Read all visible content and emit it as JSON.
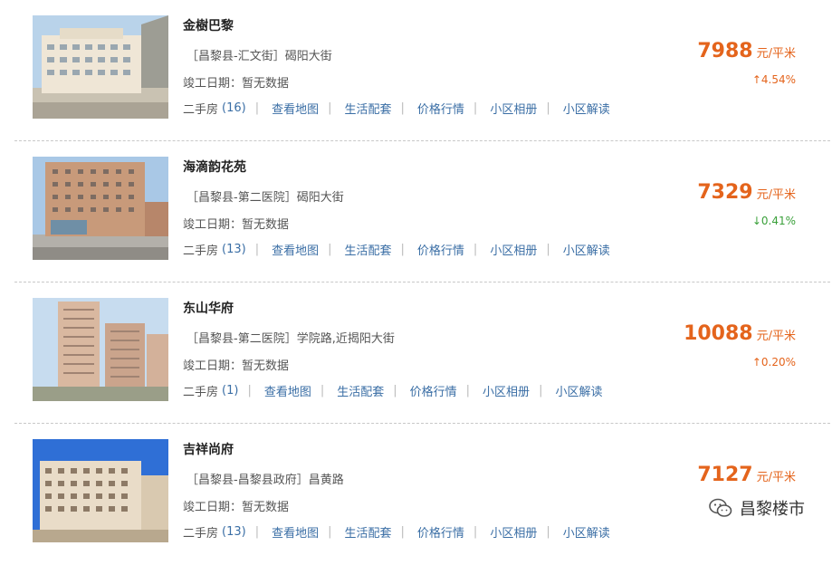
{
  "listings": [
    {
      "name": "金樹巴黎",
      "address": "［昌黎县-汇文街］碣阳大街",
      "completion": "竣工日期：暂无数据",
      "secondhand": "二手房",
      "secondhand_count": "(16)",
      "links": [
        "查看地图",
        "生活配套",
        "价格行情",
        "小区相册",
        "小区解读"
      ],
      "price": "7988",
      "unit": "元/平米",
      "change": "↑4.54%",
      "trend": "up"
    },
    {
      "name": "海滴韵花苑",
      "address": "［昌黎县-第二医院］碣阳大街",
      "completion": "竣工日期：暂无数据",
      "secondhand": "二手房",
      "secondhand_count": "(13)",
      "links": [
        "查看地图",
        "生活配套",
        "价格行情",
        "小区相册",
        "小区解读"
      ],
      "price": "7329",
      "unit": "元/平米",
      "change": "↓0.41%",
      "trend": "down"
    },
    {
      "name": "东山华府",
      "address": "［昌黎县-第二医院］学院路,近揭阳大街",
      "completion": "竣工日期：暂无数据",
      "secondhand": "二手房",
      "secondhand_count": "(1)",
      "links": [
        "查看地图",
        "生活配套",
        "价格行情",
        "小区相册",
        "小区解读"
      ],
      "price": "10088",
      "unit": "元/平米",
      "change": "↑0.20%",
      "trend": "up"
    },
    {
      "name": "吉祥尚府",
      "address": "［昌黎县-昌黎县政府］昌黄路",
      "completion": "竣工日期：暂无数据",
      "secondhand": "二手房",
      "secondhand_count": "(13)",
      "links": [
        "查看地图",
        "生活配套",
        "价格行情",
        "小区相册",
        "小区解读"
      ],
      "price": "7127",
      "unit": "元/平米",
      "change": "",
      "trend": "up"
    }
  ],
  "watermark": {
    "text": "昌黎楼市",
    "icon": "wechat-icon"
  },
  "colors": {
    "price": "#e4641c",
    "up": "#e4641c",
    "down": "#3aa03a",
    "link": "#3a6ea5"
  }
}
